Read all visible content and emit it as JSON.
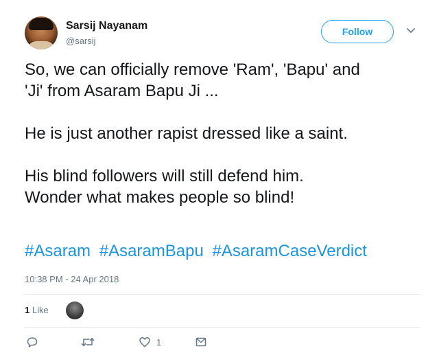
{
  "author": {
    "name": "Sarsij Nayanam",
    "handle": "@sarsij"
  },
  "follow_label": "Follow",
  "tweet": {
    "text": "So, we can officially remove 'Ram', 'Bapu' and\n'Ji' from Asaram Bapu Ji ...\n\nHe is just another rapist dressed like a saint.\n\nHis blind followers will still defend him.\nWonder what makes people so blind!",
    "hashtags": [
      "#Asaram",
      "#AsaramBapu",
      "#AsaramCaseVerdict"
    ],
    "timestamp": "10:38 PM - 24 Apr 2018"
  },
  "stats": {
    "likes_number": "1",
    "likes_label": "Like"
  },
  "actions": {
    "like_count": "1"
  },
  "icons": {
    "reply": "reply-icon",
    "retweet": "retweet-icon",
    "like": "heart-icon",
    "message": "envelope-icon",
    "caret": "chevron-down-icon"
  },
  "colors": {
    "accent": "#1da1f2",
    "hashtag": "#1b95e0",
    "muted": "#657786",
    "text": "#14171a"
  }
}
